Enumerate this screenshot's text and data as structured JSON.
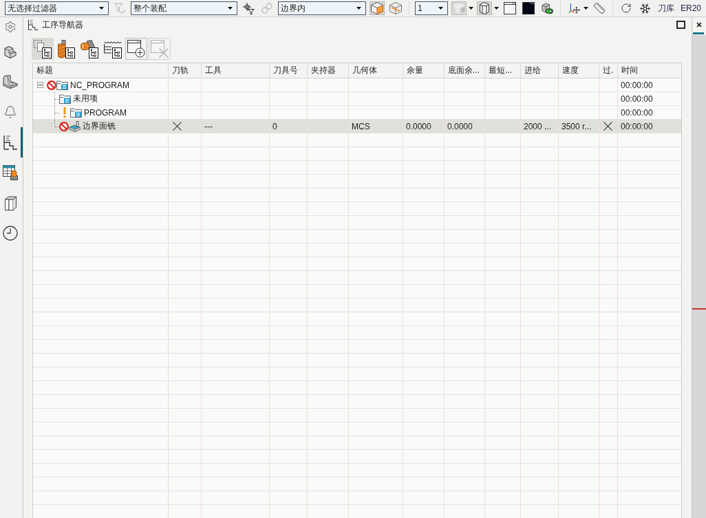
{
  "toolbar": {
    "items": [
      {
        "kind": "dropdown",
        "value": "无选择过滤器"
      },
      {
        "kind": "button",
        "selected": false,
        "disabled": true,
        "has_menu": false
      },
      {
        "kind": "dropdown",
        "value": "整个装配"
      },
      {
        "kind": "button",
        "selected": false,
        "disabled": false,
        "has_menu": false
      },
      {
        "kind": "button",
        "selected": false,
        "disabled": true,
        "has_menu": false
      },
      {
        "kind": "dropdown",
        "value": "边界内"
      },
      {
        "kind": "button",
        "selected": true,
        "disabled": false,
        "has_menu": false
      },
      {
        "kind": "button",
        "selected": false,
        "disabled": false,
        "has_menu": false
      },
      {
        "kind": "separator"
      },
      {
        "kind": "dropdown",
        "value": "1"
      },
      {
        "kind": "button",
        "selected": true,
        "disabled": false,
        "has_menu": true
      },
      {
        "kind": "button",
        "selected": true,
        "disabled": false,
        "has_menu": true
      },
      {
        "kind": "button",
        "selected": false,
        "disabled": false,
        "has_menu": false
      },
      {
        "kind": "button",
        "selected": false,
        "disabled": false,
        "has_menu": false
      },
      {
        "kind": "button",
        "selected": false,
        "disabled": false,
        "has_menu": false
      },
      {
        "kind": "separator"
      },
      {
        "kind": "button",
        "selected": false,
        "disabled": false,
        "has_menu": true
      },
      {
        "kind": "button",
        "selected": false,
        "disabled": false,
        "has_menu": false
      },
      {
        "kind": "separator"
      },
      {
        "kind": "button",
        "selected": false,
        "disabled": false,
        "has_menu": false
      },
      {
        "kind": "button",
        "selected": false,
        "disabled": false,
        "has_menu": false
      },
      {
        "kind": "text_button",
        "label": "刀库"
      },
      {
        "kind": "text_button",
        "label": "ER20"
      }
    ]
  },
  "sidebar": {
    "items": [
      {
        "selected": false
      },
      {
        "selected": false
      },
      {
        "selected": false
      },
      {
        "selected": false
      },
      {
        "selected": true
      },
      {
        "selected": false
      },
      {
        "selected": false
      },
      {
        "selected": false
      }
    ]
  },
  "panel": {
    "title": "工序导航器",
    "toolbar": [
      {
        "kind": "view",
        "selected": true,
        "disabled": false
      },
      {
        "kind": "view",
        "selected": false,
        "disabled": false
      },
      {
        "kind": "view",
        "selected": false,
        "disabled": false
      },
      {
        "kind": "view",
        "selected": false,
        "disabled": false
      },
      {
        "kind": "action",
        "selected": false,
        "disabled": false
      },
      {
        "kind": "action",
        "selected": false,
        "disabled": true
      }
    ],
    "table": {
      "columns": [
        "标题",
        "刀轨",
        "工具",
        "刀具号",
        "夹持器",
        "几何体",
        "余量",
        "底面余...",
        "最短...",
        "进给",
        "速度",
        "过.",
        "时间"
      ],
      "rows": [
        {
          "title": "NC_PROGRAM",
          "kind": "group",
          "blocked": true,
          "warning": false,
          "expanded": true,
          "selected": false,
          "time": "00:00:00",
          "children": [
            {
              "title": "未用项",
              "kind": "group",
              "blocked": false,
              "warning": false,
              "selected": false,
              "time": "00:00:00"
            },
            {
              "title": "PROGRAM",
              "kind": "group",
              "blocked": false,
              "warning": true,
              "selected": false,
              "time": "00:00:00"
            },
            {
              "title": "边界面铣",
              "kind": "operation",
              "blocked": true,
              "warning": false,
              "selected": true,
              "toolpath_generated": false,
              "tool": "---",
              "tool_number": "0",
              "geometry": "MCS",
              "stock": "0.0000",
              "floor_stock": "0.0000",
              "feed": "2000 ...",
              "speed": "3500 r...",
              "column_12_done": false,
              "time": "00:00:00"
            }
          ]
        }
      ]
    }
  }
}
